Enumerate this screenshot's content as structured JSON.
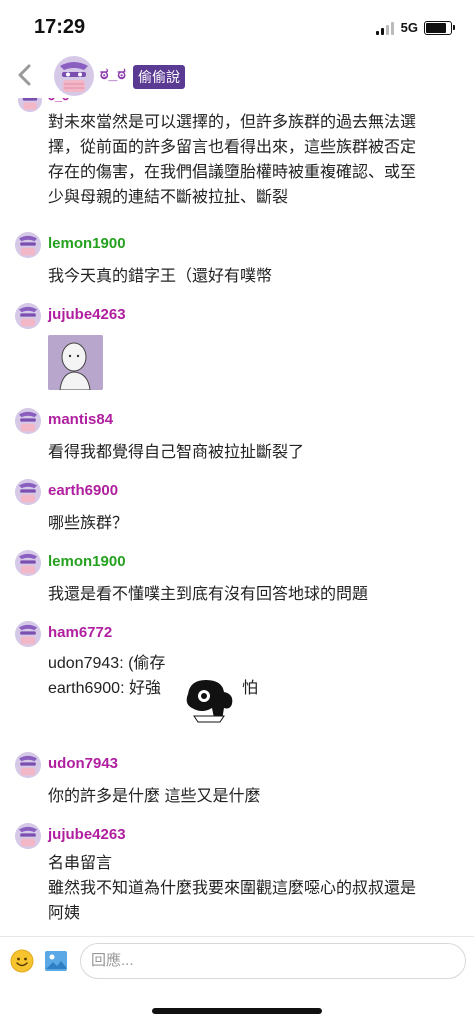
{
  "status": {
    "time": "17:29",
    "network": "5G"
  },
  "header": {
    "name": "ಠ_ಠ",
    "badge": "偷偷說"
  },
  "feed": {
    "partial": {
      "name": "ಠ_ಠ",
      "lines": [
        "對未來當然是可以選擇的，但許多族群的過去無法選",
        "擇，從前面的許多留言也看得出來，這些族群被否定",
        "存在的傷害，在我們倡議墮胎權時被重複確認、或至",
        "少與母親的連結不斷被拉扯、斷裂"
      ]
    },
    "messages": [
      {
        "name": "lemon1900",
        "text": "我今天真的錯字王（還好有噗幣"
      },
      {
        "name": "jujube4263",
        "text": ""
      },
      {
        "name": "mantis84",
        "text": "看得我都覺得自己智商被拉扯斷裂了"
      },
      {
        "name": "earth6900",
        "text": "哪些族群？"
      },
      {
        "name": "lemon1900",
        "text": "我還是看不懂噗主到底有沒有回答地球的問題"
      },
      {
        "name": "ham6772",
        "line1": "udon7943: (偷存",
        "line2_prefix": "earth6900: 好強",
        "line2_suffix": "怕"
      },
      {
        "name": "udon7943",
        "text": "你的許多是什麼 這些又是什麼"
      },
      {
        "name": "jujube4263",
        "line1": "名串留言",
        "line2": "雖然我不知道為什麼我要來圍觀這麼噁心的叔叔還是",
        "line3": "阿姨"
      }
    ]
  },
  "reply": {
    "placeholder": "回應..."
  },
  "icons": [
    "back-chevron-icon",
    "mask-avatar-icon",
    "emoji-icon",
    "image-icon",
    "blob-sticker-icon"
  ],
  "colors": {
    "green_user": "#25a11f",
    "purple_user": "#b01fa0",
    "badge_bg": "#5b3a94",
    "avatar_bg": "#d6c9e8"
  }
}
